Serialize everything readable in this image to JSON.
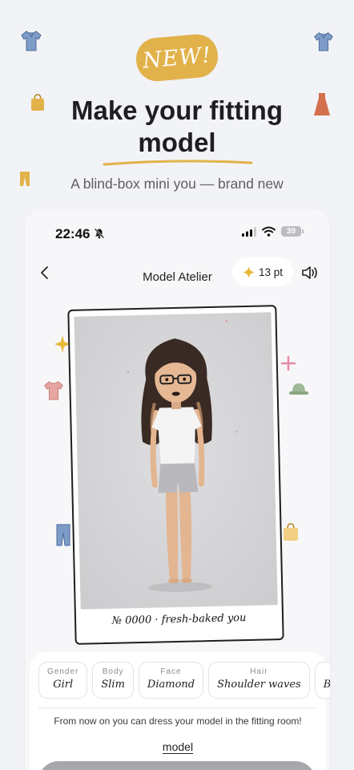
{
  "banner": {
    "badge": "NEW!",
    "headline_line1": "Make your fitting",
    "headline_line2": "model",
    "subhead": "A blind-box mini you — brand new"
  },
  "status_bar": {
    "time": "22:46",
    "battery": "39"
  },
  "nav": {
    "title": "Model Atelier",
    "points": "13 pt"
  },
  "model_card": {
    "caption": "№ 0000 · fresh-baked you"
  },
  "attributes": [
    {
      "label": "Gender",
      "value": "Girl"
    },
    {
      "label": "Body",
      "value": "Slim"
    },
    {
      "label": "Face",
      "value": "Diamond"
    },
    {
      "label": "Hair",
      "value": "Shoulder waves"
    },
    {
      "label": "",
      "value": "B"
    }
  ],
  "info": {
    "note": "From now on you can dress your model in the fitting room!",
    "link": "model"
  },
  "colors": {
    "background": "#f2f3f6",
    "badge": "#e2b24a",
    "accent_underline": "#e2b24a",
    "sparkle": "#e8b838",
    "cta_disabled": "#a7a7ab"
  },
  "icons": [
    "shirt-icon",
    "bag-icon",
    "dress-icon",
    "pants-icon",
    "hat-icon",
    "sparkle-icon",
    "star-icon",
    "chevron-left-icon",
    "speaker-icon",
    "signal-icon",
    "wifi-icon",
    "mute-bell-icon"
  ]
}
